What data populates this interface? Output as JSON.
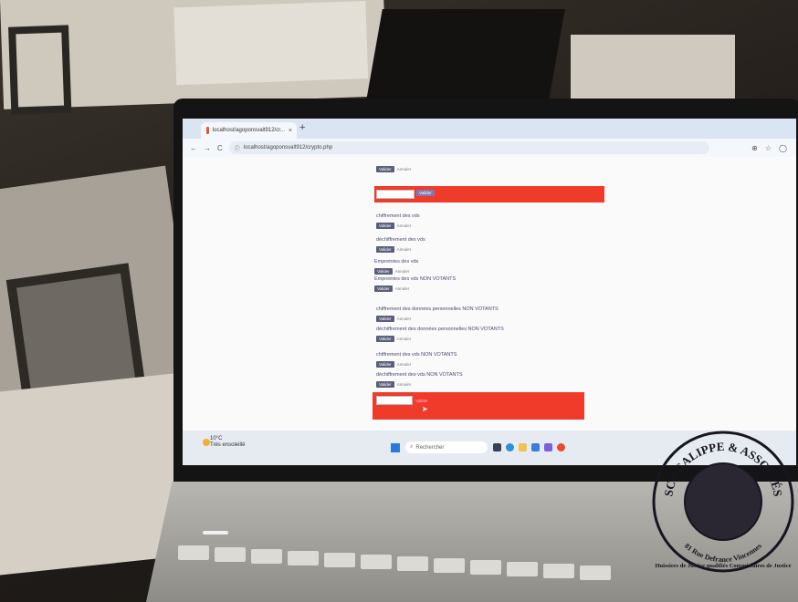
{
  "browser": {
    "tab_title": "localhost/agoponsvalt912/cr...",
    "tab_close": "×",
    "new_tab": "+",
    "back": "←",
    "forward": "→",
    "reload": "C",
    "url": "localhost/agoponsvalt912/crypto.php"
  },
  "page": {
    "top_button": "Valider",
    "top_button_label": "Annuler",
    "red_input_value": "",
    "red_submit": "Valider",
    "sections": [
      {
        "title": "chiffrement des vds",
        "button": "Valider",
        "label": "Annuler"
      },
      {
        "title": "déchiffrement des vds",
        "button": "Valider",
        "label": "Annuler"
      },
      {
        "title": "Empreintes des vds",
        "button": "Valider",
        "label": "Annuler"
      },
      {
        "title": "Empreintes des vds NON VOTANTS",
        "button": "Valider",
        "label": "Annuler"
      },
      {
        "title": "chiffrement des données personnelles NON VOTANTS",
        "button": "Valider",
        "label": "Annuler"
      },
      {
        "title": "déchiffrement des données personnelles NON VOTANTS",
        "button": "Valider",
        "label": "Annuler"
      },
      {
        "title": "chiffrement des vds NON VOTANTS",
        "button": "Valider",
        "label": "Annuler"
      },
      {
        "title": "déchiffrement des vds NON VOTANTS",
        "button": "Valider",
        "label": "Annuler"
      }
    ],
    "red2_submit": "Valider"
  },
  "taskbar": {
    "temp": "10°C",
    "weather": "Très ensoleillé",
    "search_placeholder": "Rechercher"
  },
  "stamp": {
    "top_text": "SCP CALIPPE & ASSOCIÉS",
    "address": "81 Rue Defrance Vincennes",
    "bottom_text": "Huissiers de Justice qualifiés Commissaires de Justice"
  },
  "colors": {
    "red_bar": "#f03a2a",
    "button": "#5a5f7a",
    "taskbar": "#e6ebf1"
  }
}
